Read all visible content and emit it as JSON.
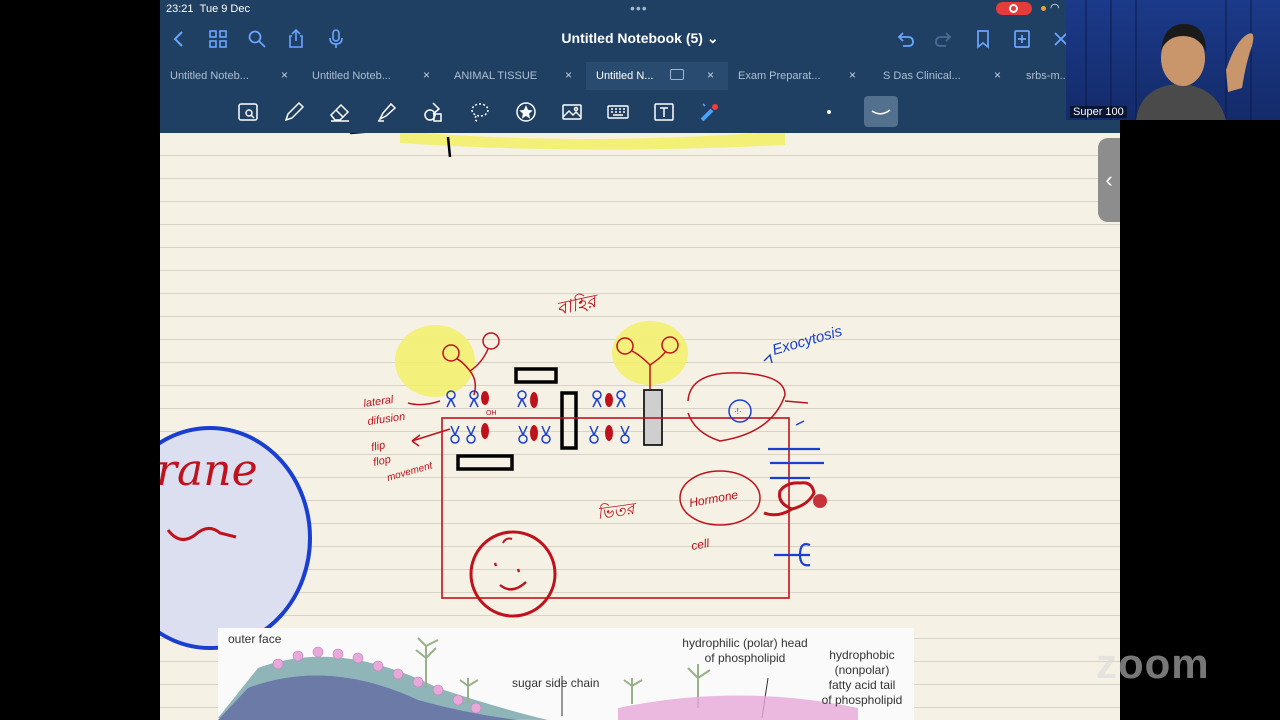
{
  "status": {
    "time": "23:21",
    "date": "Tue 9 Dec"
  },
  "notebook": {
    "title": "Untitled Notebook (5) ⌄"
  },
  "tabs": [
    {
      "label": "Untitled Noteb..."
    },
    {
      "label": "Untitled Noteb..."
    },
    {
      "label": "ANIMAL TISSUE"
    },
    {
      "label": "Untitled N..."
    },
    {
      "label": "Exam Preparat..."
    },
    {
      "label": "S Das Clinical..."
    },
    {
      "label": "srbs-m..."
    }
  ],
  "tab_close": "×",
  "annotations": {
    "bahir": "বাহির",
    "exocytosis": "Exocytosis",
    "lateral_diffusion": "lateral diffusion",
    "flip_flop": "flip flop movement",
    "bhitor": "ভিতর",
    "hormone": "Hormone",
    "cell": "cell",
    "oh": "OH",
    "big_text": "rane"
  },
  "figure": {
    "outer_face": "outer face",
    "hydrophilic": "hydrophilic (polar) head\nof phospholipid",
    "hydrophobic": "hydrophobic\n(nonpolar)\nfatty acid tail\nof phospholipid",
    "sugar": "sugar side chain"
  },
  "video": {
    "name": "Super 100"
  },
  "zoom": {
    "logo": "zoom"
  },
  "colors": {
    "nav": "#1f3f63",
    "ink_red": "#c0121c",
    "ink_blue": "#1a3fd0",
    "highlight": "#f3f06a"
  }
}
